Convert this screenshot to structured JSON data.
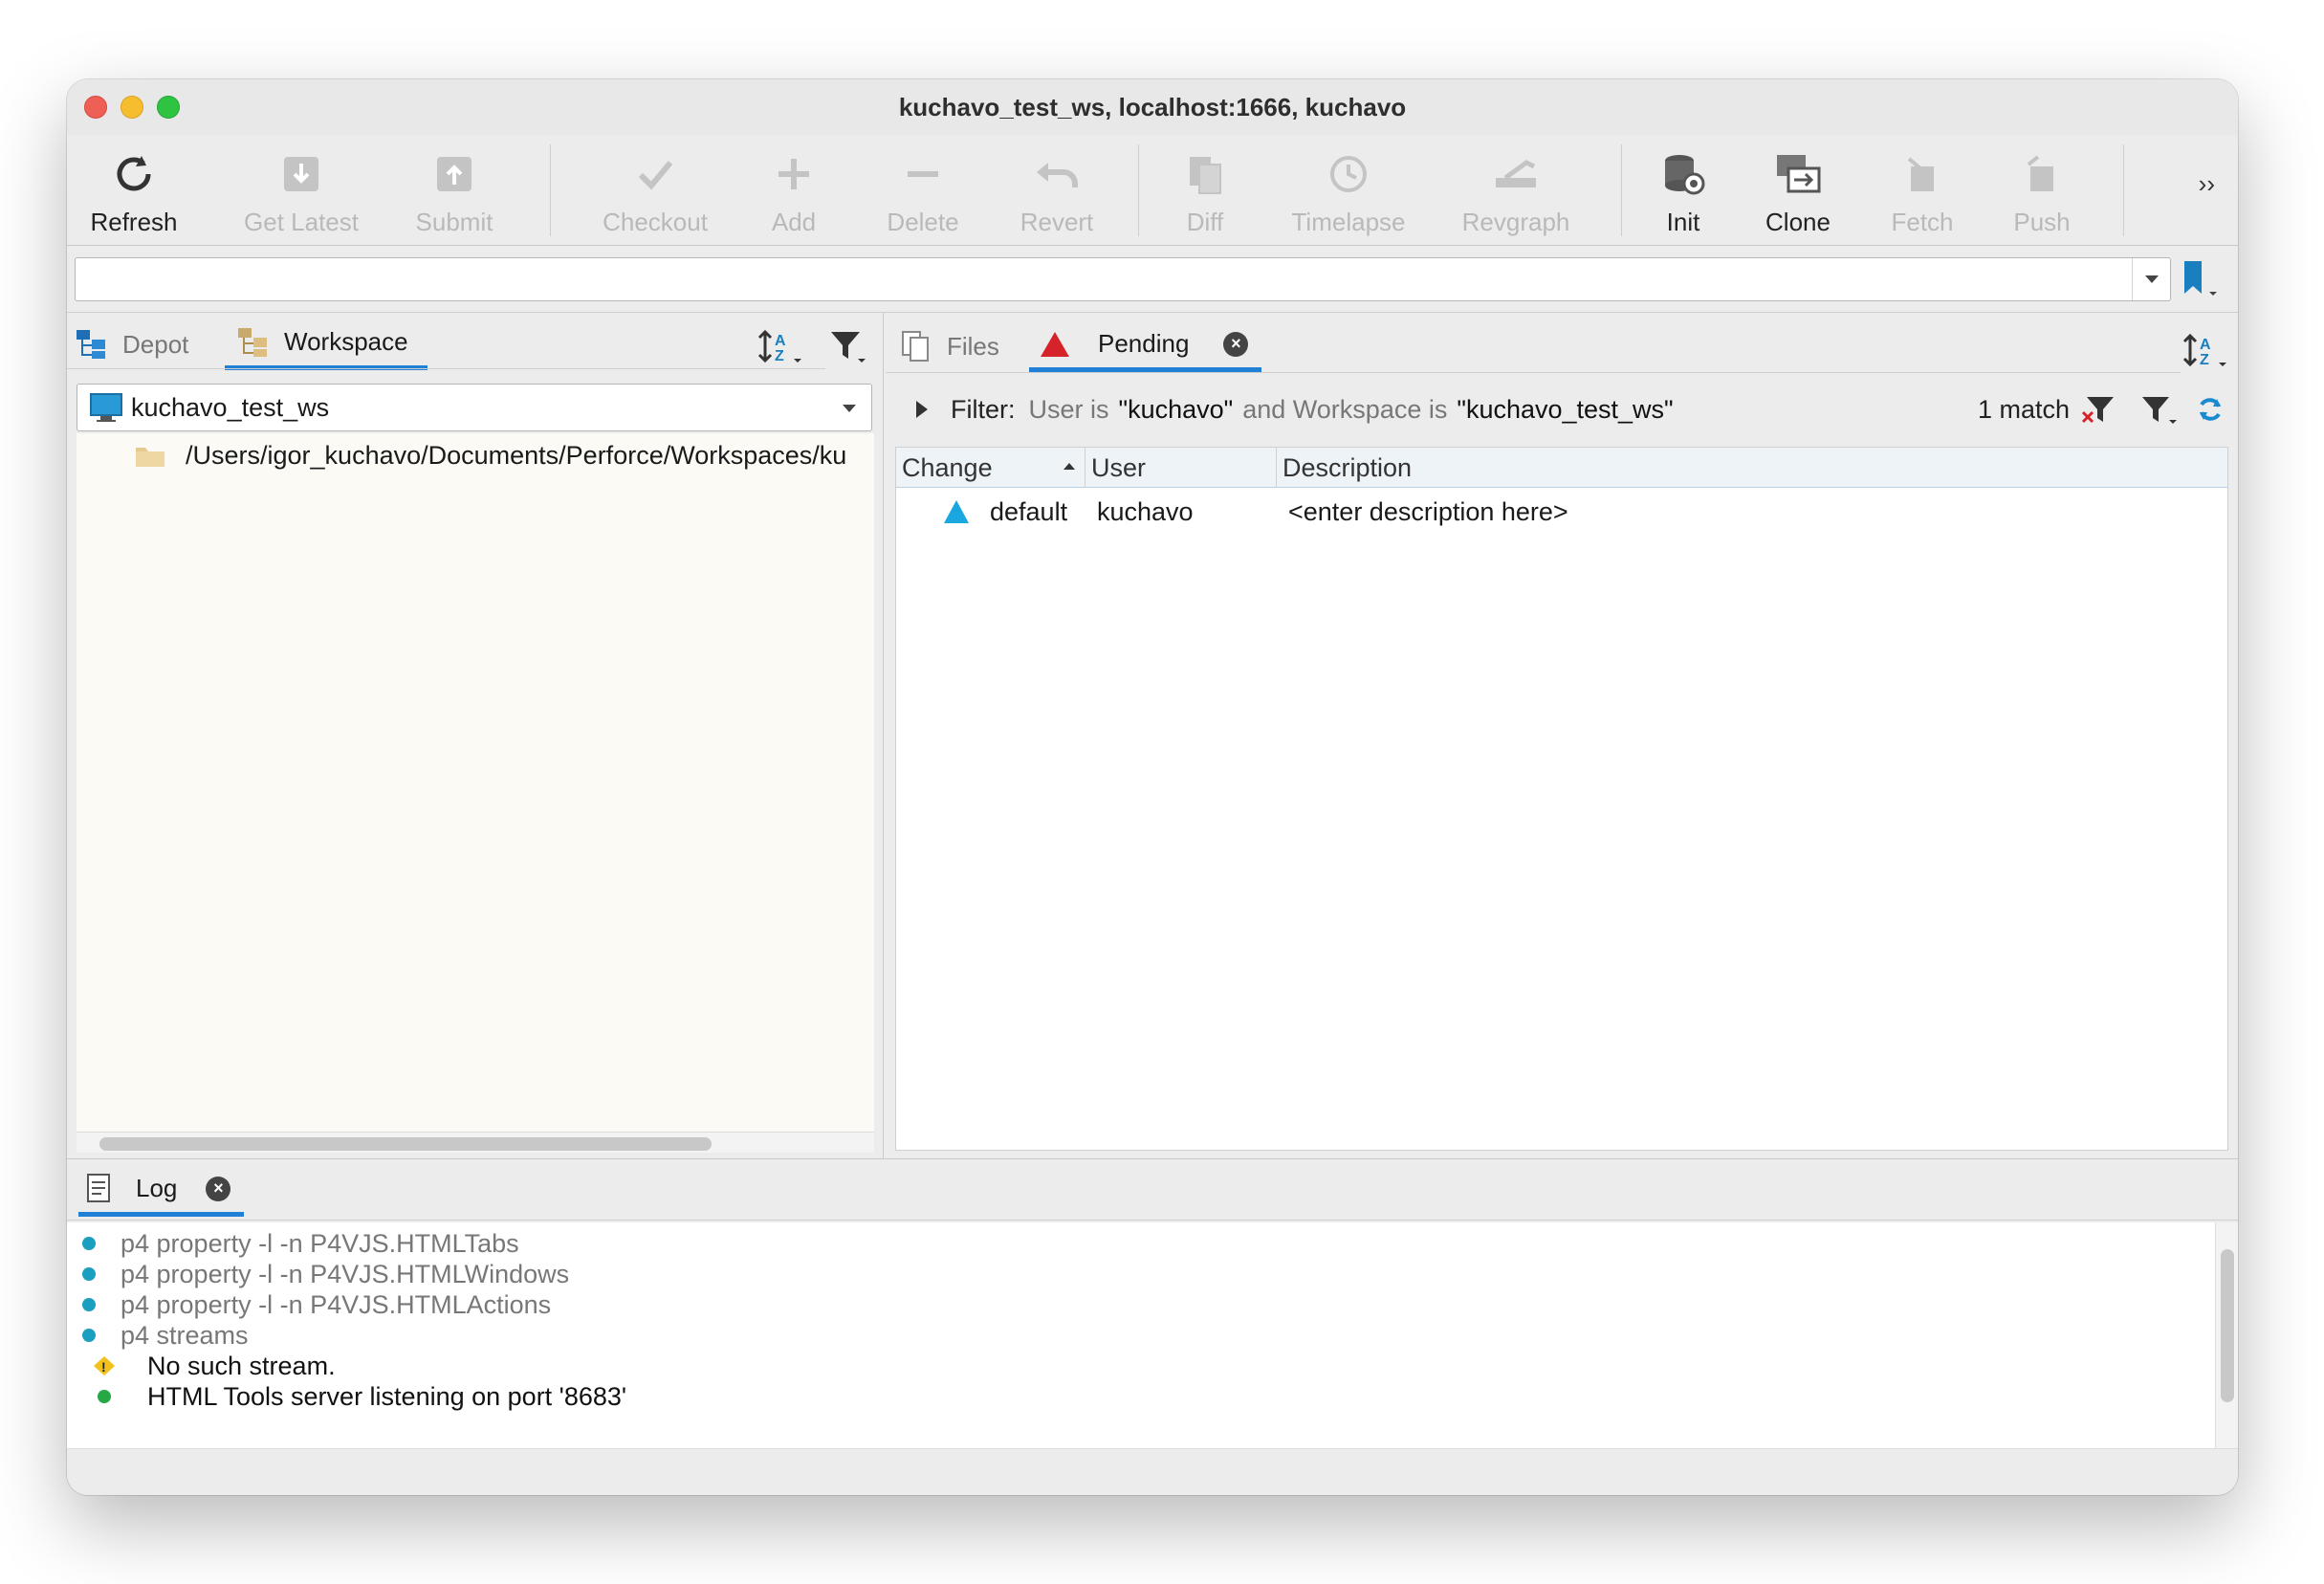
{
  "window": {
    "title": "kuchavo_test_ws,  localhost:1666,  kuchavo"
  },
  "toolbar": {
    "refresh": "Refresh",
    "get_latest": "Get Latest",
    "submit": "Submit",
    "checkout": "Checkout",
    "add": "Add",
    "delete": "Delete",
    "revert": "Revert",
    "diff": "Diff",
    "timelapse": "Timelapse",
    "revgraph": "Revgraph",
    "init": "Init",
    "clone": "Clone",
    "fetch": "Fetch",
    "push": "Push",
    "overflow": "››"
  },
  "path_bar": {
    "value": ""
  },
  "left": {
    "tabs": {
      "depot": "Depot",
      "workspace": "Workspace"
    },
    "workspace_selected": "kuchavo_test_ws",
    "tree": {
      "path": "/Users/igor_kuchavo/Documents/Perforce/Workspaces/ku"
    }
  },
  "right": {
    "tabs": {
      "files": "Files",
      "pending": "Pending"
    },
    "filter": {
      "label": "Filter:",
      "t1": "User is",
      "v1": "\"kuchavo\"",
      "t2": "and Workspace is",
      "v2": "\"kuchavo_test_ws\"",
      "match": "1 match"
    },
    "table": {
      "columns": {
        "change": "Change",
        "user": "User",
        "description": "Description"
      },
      "rows": [
        {
          "change": "default",
          "user": "kuchavo",
          "description": "<enter description here>"
        }
      ]
    }
  },
  "log": {
    "tab": "Log",
    "lines": [
      {
        "text": "p4 property -l -n P4VJS.HTMLTabs",
        "level": "cmd"
      },
      {
        "text": "p4 property -l -n P4VJS.HTMLWindows",
        "level": "cmd"
      },
      {
        "text": "p4 property -l -n P4VJS.HTMLActions",
        "level": "cmd"
      },
      {
        "text": "p4 streams",
        "level": "cmd"
      },
      {
        "text": "No such stream.",
        "level": "warn"
      },
      {
        "text": "HTML Tools server listening on port '8683'",
        "level": "ok"
      }
    ]
  },
  "colors": {
    "accent": "#1f80d6",
    "pending_red": "#d6232a",
    "change_blue": "#1aa7e0",
    "cmd_dot": "#1a9fc0",
    "ok_dot": "#27a844",
    "warn": "#f3c11b"
  }
}
